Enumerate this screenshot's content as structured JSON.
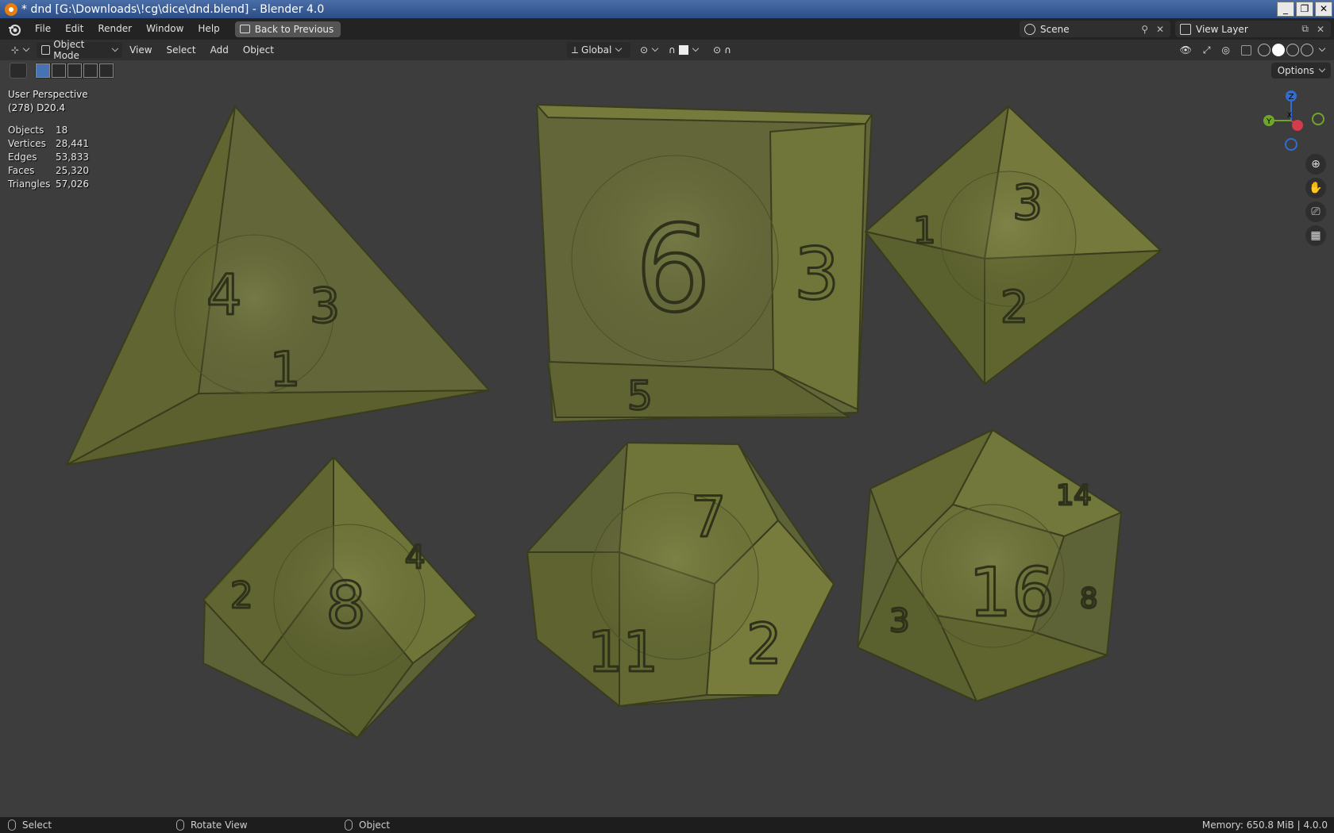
{
  "window": {
    "title": "* dnd [G:\\Downloads\\!cg\\dice\\dnd.blend] - Blender 4.0"
  },
  "menu": {
    "items": [
      "File",
      "Edit",
      "Render",
      "Window",
      "Help"
    ],
    "back_button": "Back to Previous"
  },
  "scene": {
    "name": "Scene",
    "view_layer": "View Layer"
  },
  "header": {
    "mode": "Object Mode",
    "menus": [
      "View",
      "Select",
      "Add",
      "Object"
    ],
    "orientation": "Global",
    "options": "Options"
  },
  "viewport": {
    "perspective": "User Perspective",
    "active_object": "(278) D20.4",
    "stats": [
      {
        "label": "Objects",
        "value": "18"
      },
      {
        "label": "Vertices",
        "value": "28,441"
      },
      {
        "label": "Edges",
        "value": "53,833"
      },
      {
        "label": "Faces",
        "value": "25,320"
      },
      {
        "label": "Triangles",
        "value": "57,026"
      }
    ],
    "gizmo": {
      "z": "Z",
      "y": "Y",
      "x": "X"
    },
    "dice_color": "#7a7f3e"
  },
  "status": {
    "select": "Select",
    "rotate": "Rotate View",
    "object": "Object",
    "memory": "Memory: 650.8 MiB | 4.0.0"
  }
}
